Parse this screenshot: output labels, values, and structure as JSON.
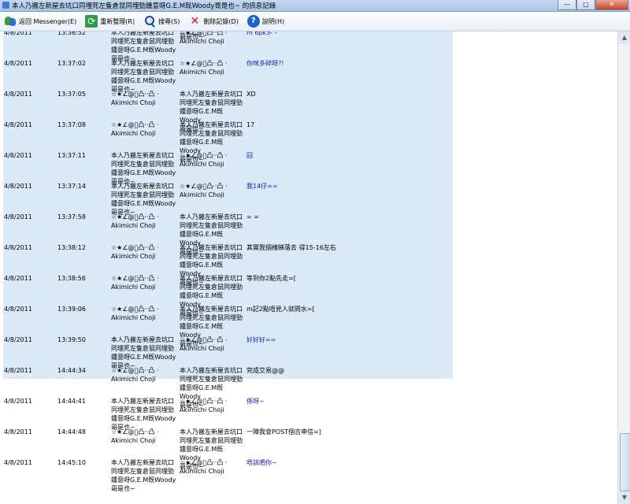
{
  "window": {
    "title": "本人乃搬左新屋去坑口同埋死左隻倉鼠同埋勁鍾意呀G.E.M既Woody哥是也~ 的訊息記錄",
    "minimize": "—",
    "maximize": "□",
    "close": "✕"
  },
  "toolbar": {
    "back_label": "返回 Messenger(E)",
    "refresh_label": "重新整理(R)",
    "search_label": "搜尋(S)",
    "delete_label": "刪除記錄(D)",
    "help_label": "說明(H)"
  },
  "users": {
    "woody": [
      "本人乃搬左新屋去坑口",
      "同埋死左隻倉鼠同埋勁",
      "鍾意呀G.E.M既Woody",
      "哥是也~"
    ],
    "akimichi": [
      "☆★∠@゚凸··凸 ·",
      "Akimichi Choji"
    ]
  },
  "top_fragment": "哥是也~",
  "messages": [
    {
      "date": "4/8/2011",
      "time": "13:36:52",
      "from": "woody",
      "to": "akimichi",
      "text": "m 6pk3- -",
      "blue": true
    },
    {
      "date": "4/8/2011",
      "time": "13:37:02",
      "from": "woody",
      "to": "akimichi",
      "text": "你咪多碎呀?!",
      "blue": true
    },
    {
      "date": "4/8/2011",
      "time": "13:37:05",
      "from": "akimichi",
      "to": "woody",
      "text": "XD",
      "blue": false
    },
    {
      "date": "4/8/2011",
      "time": "13:37:08",
      "from": "akimichi",
      "to": "woody",
      "text": "17",
      "blue": false
    },
    {
      "date": "4/8/2011",
      "time": "13:37:11",
      "from": "woody",
      "to": "akimichi",
      "text": "囧",
      "blue": true
    },
    {
      "date": "4/8/2011",
      "time": "13:37:14",
      "from": "woody",
      "to": "akimichi",
      "text": "我14仔==",
      "blue": true
    },
    {
      "date": "4/8/2011",
      "time": "13:37:58",
      "from": "akimichi",
      "to": "woody",
      "text": "= =",
      "blue": false
    },
    {
      "date": "4/8/2011",
      "time": "13:38:12",
      "from": "akimichi",
      "to": "woody",
      "text": "其實我個樣睇落去 得15-16左右",
      "blue": false
    },
    {
      "date": "4/8/2011",
      "time": "13:38:56",
      "from": "akimichi",
      "to": "woody",
      "text": "等到你2點先走=[",
      "blue": false
    },
    {
      "date": "4/8/2011",
      "time": "13:39:06",
      "from": "akimichi",
      "to": "woody",
      "text": "m記2點唔見人就問水=[",
      "blue": false
    },
    {
      "date": "4/8/2011",
      "time": "13:39:50",
      "from": "woody",
      "to": "akimichi",
      "text": "好好好==",
      "blue": true
    },
    {
      "date": "4/8/2011",
      "time": "14:44:34",
      "from": "akimichi",
      "to": "woody",
      "text": "完成交易@@",
      "blue": false
    },
    {
      "date": "4/8/2011",
      "time": "14:44:41",
      "from": "woody",
      "to": "akimichi",
      "text": "係呀~",
      "blue": true
    },
    {
      "date": "4/8/2011",
      "time": "14:44:48",
      "from": "akimichi",
      "to": "woody",
      "text": "一陣我會POST個吉申信=]",
      "blue": false
    },
    {
      "date": "4/8/2011",
      "time": "14:45:10",
      "from": "woody",
      "to": "akimichi",
      "text": "唔該晒你~",
      "blue": true
    }
  ],
  "scrollbar": {
    "up": "▲",
    "down": "▼"
  }
}
